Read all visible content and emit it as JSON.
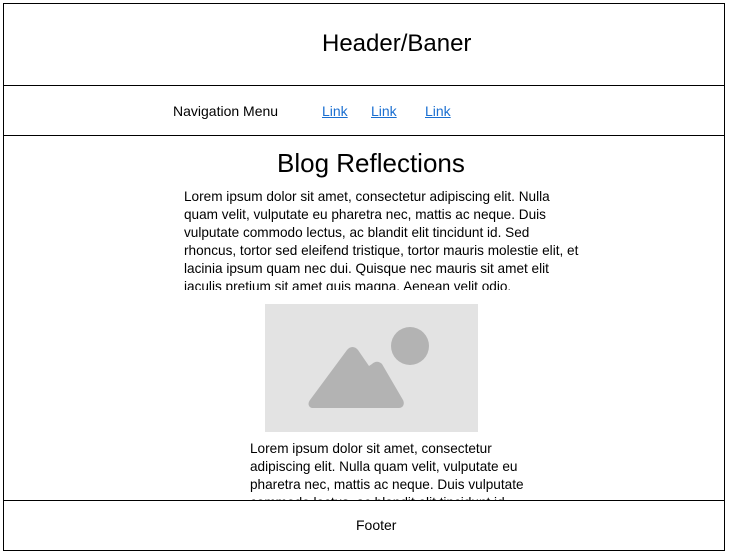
{
  "header": {
    "title": "Header/Baner"
  },
  "nav": {
    "label": "Navigation Menu",
    "links": [
      "Link",
      "Link",
      "Link"
    ],
    "link_color": "#1a6fd1"
  },
  "main": {
    "title": "Blog Reflections",
    "paragraph1": "Lorem ipsum dolor sit amet, consectetur adipiscing elit. Nulla quam velit, vulputate eu pharetra nec, mattis ac neque. Duis vulputate commodo lectus, ac blandit elit tincidunt id. Sed rhoncus, tortor sed eleifend tristique, tortor mauris molestie elit, et lacinia ipsum quam nec dui. Quisque nec mauris sit amet elit iaculis pretium sit amet quis magna. Aenean velit odio,",
    "image": {
      "icon": "image-placeholder-icon",
      "background": "#e3e3e3",
      "shape_color": "#b3b3b3"
    },
    "paragraph2": "Lorem ipsum dolor sit amet, consectetur adipiscing elit. Nulla quam velit, vulputate eu pharetra nec, mattis ac neque. Duis vulputate commodo lectus, ac blandit elit tincidunt id."
  },
  "footer": {
    "text": "Footer"
  }
}
